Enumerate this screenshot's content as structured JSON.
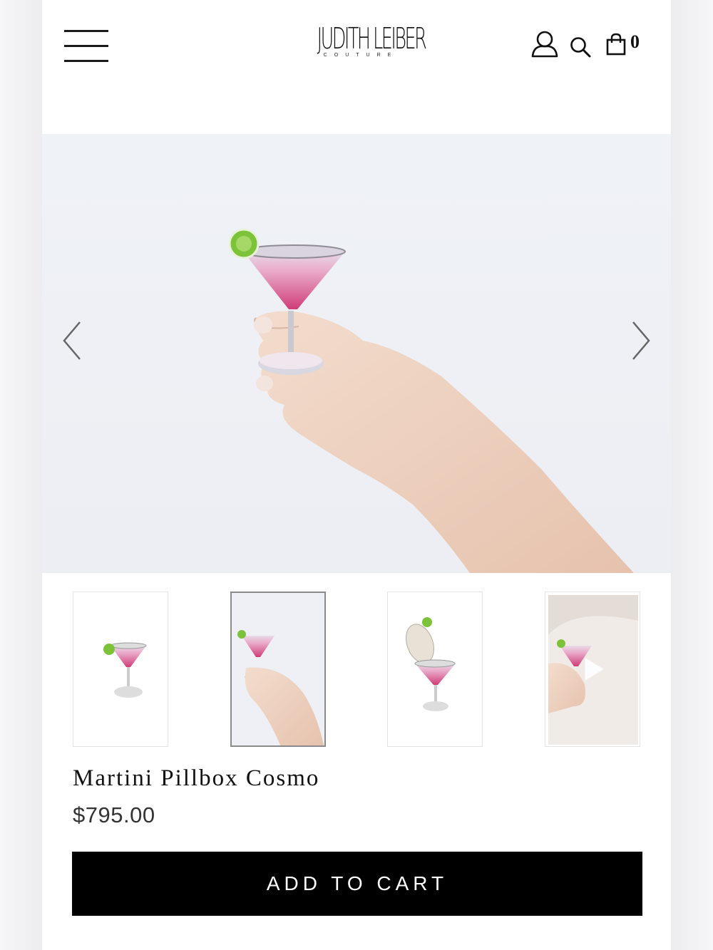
{
  "header": {
    "brand_name": "JUDITH LEIBER",
    "brand_sub": "COUTURE",
    "cart_count": "0",
    "icons": [
      "menu-icon",
      "user-icon",
      "search-icon",
      "bag-icon"
    ]
  },
  "gallery": {
    "selected_index": 1,
    "thumbnails": [
      "martini-pillbox-front",
      "martini-pillbox-in-hand",
      "martini-pillbox-open",
      "martini-pillbox-video"
    ]
  },
  "product": {
    "title": "Martini Pillbox Cosmo",
    "price": "$795.00",
    "add_to_cart_label": "ADD TO CART"
  },
  "colors": {
    "button_bg": "#000000",
    "button_text": "#ffffff",
    "accent_pink": "#d6508a",
    "lime": "#7cc33a"
  }
}
